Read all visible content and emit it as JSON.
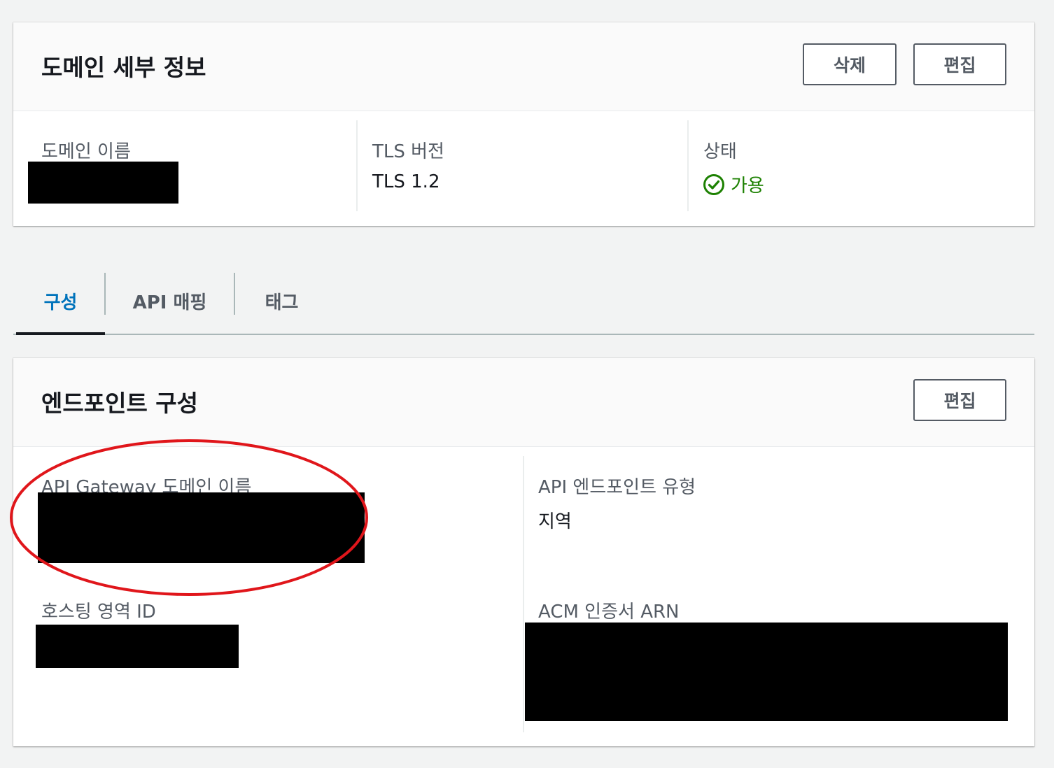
{
  "domain_details": {
    "title": "도메인 세부 정보",
    "delete_label": "삭제",
    "edit_label": "편집",
    "fields": {
      "domain_name": {
        "label": "도메인 이름",
        "value": ""
      },
      "tls_version": {
        "label": "TLS 버전",
        "value": "TLS 1.2"
      },
      "status": {
        "label": "상태",
        "value": "가용",
        "icon": "check-circle-icon",
        "color": "#1d8102"
      }
    }
  },
  "tabs": [
    {
      "label": "구성",
      "active": true
    },
    {
      "label": "API 매핑",
      "active": false
    },
    {
      "label": "태그",
      "active": false
    }
  ],
  "endpoint_config": {
    "title": "엔드포인트 구성",
    "edit_label": "편집",
    "fields": {
      "api_gateway_domain_name": {
        "label": "API Gateway 도메인 이름",
        "value": ""
      },
      "api_endpoint_type": {
        "label": "API 엔드포인트 유형",
        "value": "지역"
      },
      "hosted_zone_id": {
        "label": "호스팅 영역 ID",
        "value": ""
      },
      "acm_certificate_arn": {
        "label": "ACM 인증서 ARN",
        "value": ""
      }
    }
  },
  "colors": {
    "accent": "#0073bb",
    "annotation": "#e0161b",
    "redaction": "#000000"
  }
}
